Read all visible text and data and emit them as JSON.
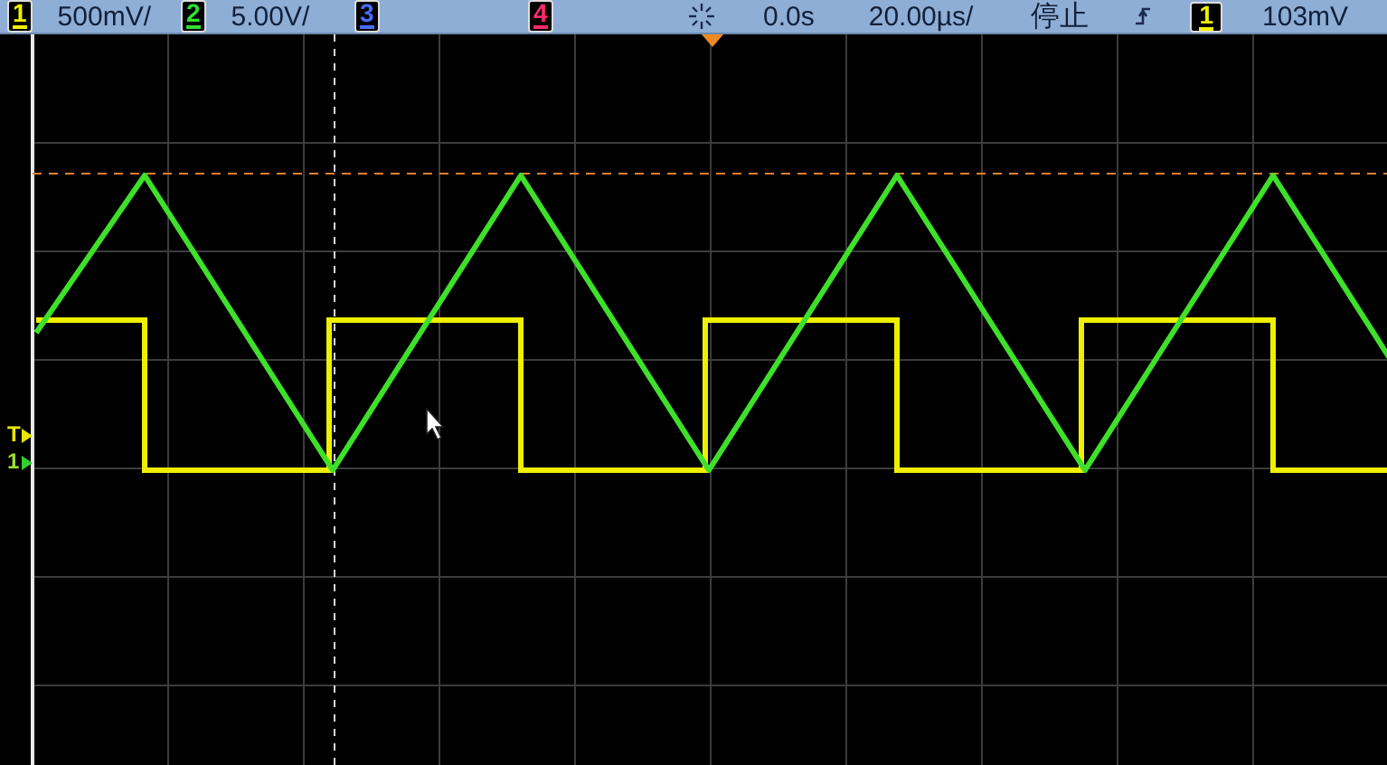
{
  "top_bar": {
    "channels": [
      {
        "number": "1",
        "scale": "500mV/",
        "color": "#f0f000"
      },
      {
        "number": "2",
        "scale": "5.00V/",
        "color": "#30e030"
      },
      {
        "number": "3",
        "color": "#4a6cff"
      },
      {
        "number": "4",
        "color": "#ff2a6a"
      }
    ],
    "time_offset": "0.0s",
    "timebase": "20.00µs/",
    "run_state": "停止",
    "trigger": {
      "source": "1",
      "level": "103mV",
      "color": "#f0f000"
    }
  },
  "display": {
    "markers": [
      {
        "label": "T"
      },
      {
        "label": "1"
      }
    ]
  }
}
